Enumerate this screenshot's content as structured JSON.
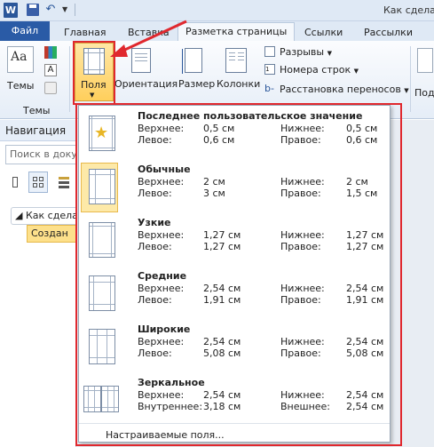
{
  "app": {
    "icon_letter": "W",
    "window_title": "Как сделат"
  },
  "tabs": [
    {
      "label": "Файл"
    },
    {
      "label": "Главная"
    },
    {
      "label": "Вставка"
    },
    {
      "label": "Разметка страницы"
    },
    {
      "label": "Ссылки"
    },
    {
      "label": "Рассылки"
    }
  ],
  "ribbon": {
    "themes_label": "Темы",
    "themes_group": "Темы",
    "fields_label": "Поля",
    "orientation_label": "Ориентация",
    "size_label": "Размер",
    "columns_label": "Колонки",
    "breaks_label": "Разрывы",
    "line_numbers_label": "Номера строк",
    "hyphenation_label": "Расстановка переносов",
    "right_cut_label": "Под"
  },
  "navigation": {
    "title": "Навигация",
    "search_placeholder": "Поиск в докум",
    "heading_item": "Как сделат",
    "selected_item": "Создан"
  },
  "gallery": {
    "items": [
      {
        "name": "Последнее пользовательское значение",
        "label1": "Верхнее:",
        "v1": "0,5 см",
        "label2": "Нижнее:",
        "v2": "0,5 см",
        "label3": "Левое:",
        "v3": "0,6 см",
        "label4": "Правое:",
        "v4": "0,6 см"
      },
      {
        "name": "Обычные",
        "label1": "Верхнее:",
        "v1": "2 см",
        "label2": "Нижнее:",
        "v2": "2 см",
        "label3": "Левое:",
        "v3": "3 см",
        "label4": "Правое:",
        "v4": "1,5 см"
      },
      {
        "name": "Узкие",
        "label1": "Верхнее:",
        "v1": "1,27 см",
        "label2": "Нижнее:",
        "v2": "1,27 см",
        "label3": "Левое:",
        "v3": "1,27 см",
        "label4": "Правое:",
        "v4": "1,27 см"
      },
      {
        "name": "Средние",
        "label1": "Верхнее:",
        "v1": "2,54 см",
        "label2": "Нижнее:",
        "v2": "2,54 см",
        "label3": "Левое:",
        "v3": "1,91 см",
        "label4": "Правое:",
        "v4": "1,91 см"
      },
      {
        "name": "Широкие",
        "label1": "Верхнее:",
        "v1": "2,54 см",
        "label2": "Нижнее:",
        "v2": "2,54 см",
        "label3": "Левое:",
        "v3": "5,08 см",
        "label4": "Правое:",
        "v4": "5,08 см"
      },
      {
        "name": "Зеркальное",
        "label1": "Верхнее:",
        "v1": "2,54 см",
        "label2": "Нижнее:",
        "v2": "2,54 см",
        "label3": "Внутреннее:",
        "v3": "3,18 см",
        "label4": "Внешнее:",
        "v4": "2,54 см"
      }
    ],
    "footer": "Настраиваемые поля..."
  },
  "colors": {
    "accent": "#2a5ba6",
    "highlight": "#fde9a8",
    "annotation": "#e0282e"
  }
}
